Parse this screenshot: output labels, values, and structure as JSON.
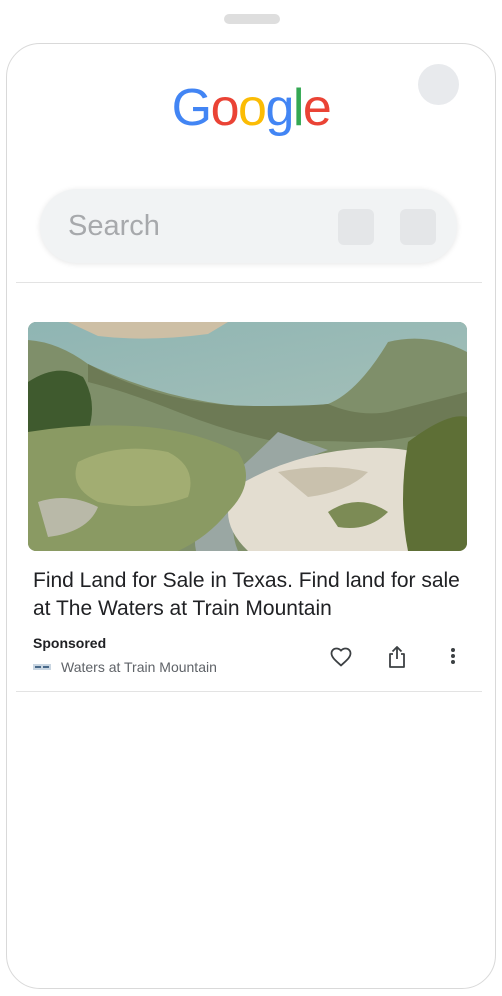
{
  "logo": {
    "letters": [
      "G",
      "o",
      "o",
      "g",
      "l",
      "e"
    ],
    "colors": [
      "#4285F4",
      "#EA4335",
      "#FBBC05",
      "#4285F4",
      "#34A853",
      "#EA4335"
    ]
  },
  "search": {
    "placeholder": "Search"
  },
  "ad": {
    "title": "Find Land for Sale in Texas. Find land for sale at The Waters at Train Mountain",
    "sponsored_label": "Sponsored",
    "advertiser": "Waters at Train Mountain"
  },
  "icons": {
    "like": "heart-icon",
    "share": "share-icon",
    "more": "more-vert-icon"
  }
}
